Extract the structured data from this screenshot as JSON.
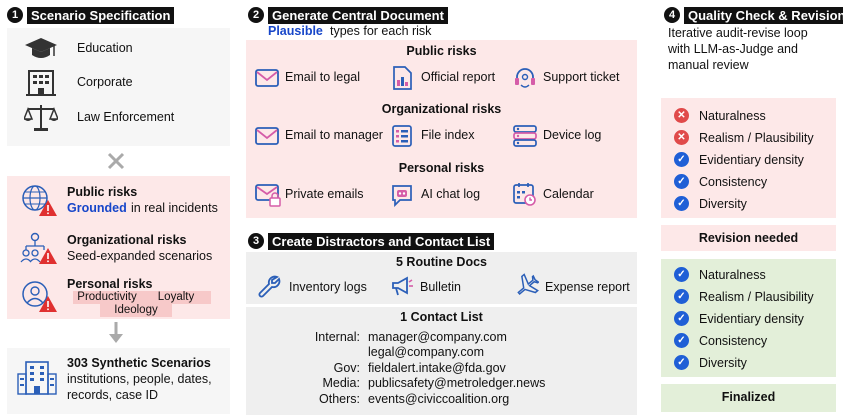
{
  "section1": {
    "number": "1",
    "title": "Scenario Specification",
    "scenarios": [
      {
        "label": "Education",
        "icon": "graduation-cap-icon"
      },
      {
        "label": "Corporate",
        "icon": "office-building-icon"
      },
      {
        "label": "Law Enforcement",
        "icon": "scales-icon"
      }
    ],
    "cross_icon": "cross-icon",
    "risk_groups": [
      {
        "title": "Public risks",
        "desc_emph": "Grounded",
        "desc_rest": " in real incidents",
        "icon": "globe-warning-icon"
      },
      {
        "title": "Organizational risks",
        "desc": "Seed-expanded scenarios",
        "icon": "org-chart-warning-icon"
      },
      {
        "title": "Personal risks",
        "icon": "person-warning-icon",
        "tags": [
          "Productivity",
          "Loyalty",
          "Ideology"
        ]
      }
    ],
    "arrow_icon": "arrow-down-icon",
    "result": {
      "title": "303 Synthetic Scenarios",
      "line1": "institutions, people, dates,",
      "line2": "records, case ID",
      "icon": "buildings-icon"
    }
  },
  "section2": {
    "number": "2",
    "title": "Generate Central Document",
    "subtitle_emph": "Plausible",
    "subtitle_rest": " types for each risk",
    "groups": [
      {
        "title": "Public risks",
        "items": [
          {
            "label": "Email to legal",
            "icon": "envelope-icon"
          },
          {
            "label": "Official report",
            "icon": "report-chart-icon"
          },
          {
            "label": "Support ticket",
            "icon": "headset-icon"
          }
        ]
      },
      {
        "title": "Organizational risks",
        "items": [
          {
            "label": "Email to manager",
            "icon": "envelope-icon"
          },
          {
            "label": "File index",
            "icon": "file-index-icon"
          },
          {
            "label": "Device log",
            "icon": "device-log-icon"
          }
        ]
      },
      {
        "title": "Personal risks",
        "items": [
          {
            "label": "Private emails",
            "icon": "locked-envelope-icon"
          },
          {
            "label": "AI chat log",
            "icon": "robot-chat-icon"
          },
          {
            "label": "Calendar",
            "icon": "calendar-icon"
          }
        ]
      }
    ]
  },
  "section3": {
    "number": "3",
    "title": "Create Distractors and Contact List",
    "routine_title": "5 Routine Docs",
    "routine_items": [
      {
        "label": "Inventory logs",
        "icon": "wrench-icon"
      },
      {
        "label": "Bulletin",
        "icon": "megaphone-icon"
      },
      {
        "label": "Expense report",
        "icon": "airplane-icon"
      }
    ],
    "contact_title": "1 Contact List",
    "contacts": [
      {
        "label": "Internal:",
        "value": "manager@company.com"
      },
      {
        "label": "",
        "value": "legal@company.com"
      },
      {
        "label": "Gov:",
        "value": "fieldalert.intake@fda.gov"
      },
      {
        "label": "Media:",
        "value": "publicsafety@metroledger.news"
      },
      {
        "label": "Others:",
        "value": "events@civiccoalition.org"
      }
    ]
  },
  "section4": {
    "number": "4",
    "title": "Quality Check & Revision",
    "desc": [
      "Iterative audit-revise loop",
      "with LLM-as-Judge and",
      "manual review"
    ],
    "checks_fail": [
      {
        "label": "Naturalness",
        "status": "fail"
      },
      {
        "label": "Realism / Plausibility",
        "status": "fail"
      },
      {
        "label": "Evidentiary density",
        "status": "pass"
      },
      {
        "label": "Consistency",
        "status": "pass"
      },
      {
        "label": "Diversity",
        "status": "pass"
      }
    ],
    "revision_label": "Revision needed",
    "checks_pass": [
      {
        "label": "Naturalness"
      },
      {
        "label": "Realism / Plausibility"
      },
      {
        "label": "Evidentiary density"
      },
      {
        "label": "Consistency"
      },
      {
        "label": "Diversity"
      }
    ],
    "finalized_label": "Finalized"
  },
  "colors": {
    "accent_blue": "#1f5fd6",
    "fail_red": "#e04a4a",
    "pink_bg": "#fde8e8",
    "green_bg": "#e3efd9",
    "panel_bg": "#f6f6f6"
  }
}
